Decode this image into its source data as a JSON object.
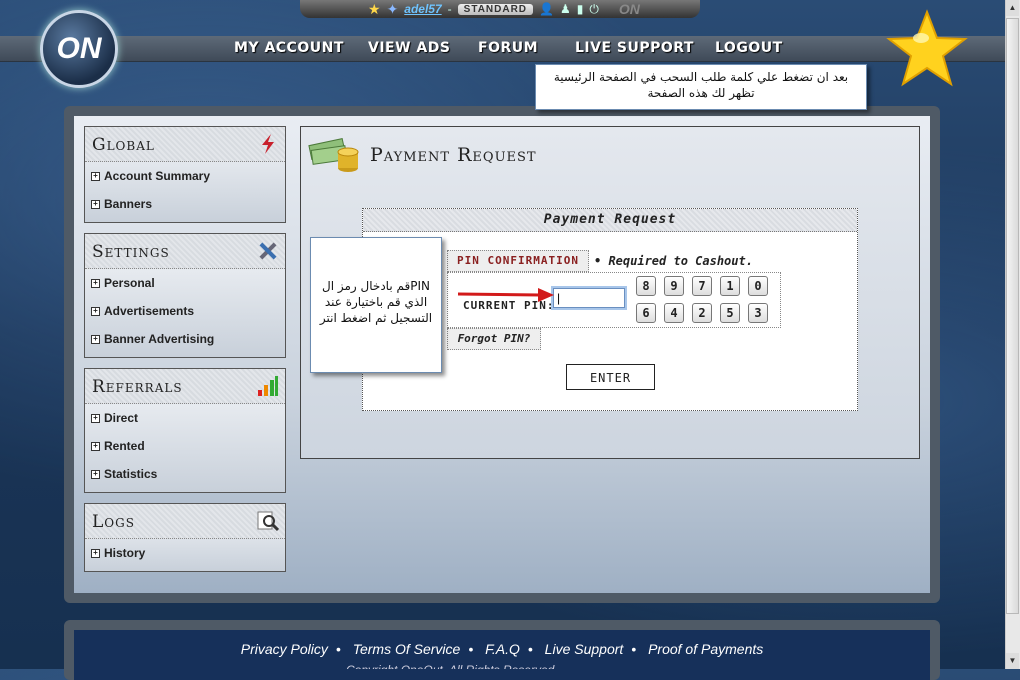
{
  "topbar": {
    "username": "adel57",
    "dash": "-",
    "membership": "STANDARD",
    "logo_small": "ON"
  },
  "logo": {
    "text": "ON"
  },
  "nav": {
    "my_account": "MY ACCOUNT",
    "view_ads": "VIEW ADS",
    "forum": "FORUM",
    "live_support": "LIVE SUPPORT",
    "logout": "LOGOUT"
  },
  "callout_top": "بعد ان تضغط علي كلمة طلب السحب في الصفحة الرئيسية تظهر لك هذه الصفحة",
  "callout_left": "PINقم بادخال رمز ال الذي قم باختيارة عند التسجيل ثم اضغط انتر",
  "sidebar": {
    "global": {
      "title": "Global",
      "items": [
        "Account Summary",
        "Banners"
      ]
    },
    "settings": {
      "title": "Settings",
      "items": [
        "Personal",
        "Advertisements",
        "Banner Advertising"
      ]
    },
    "referrals": {
      "title": "Referrals",
      "items": [
        "Direct",
        "Rented",
        "Statistics"
      ]
    },
    "logs": {
      "title": "Logs",
      "items": [
        "History"
      ]
    }
  },
  "page": {
    "title": "Payment Request",
    "form_title": "Payment Request",
    "pin_confirmation": "PIN CONFIRMATION",
    "required_note": "• Required to Cashout.",
    "current_pin_label": "CURRENT PIN:",
    "pin_value": "|",
    "keypad_row1": [
      "8",
      "9",
      "7",
      "1",
      "0"
    ],
    "keypad_row2": [
      "6",
      "4",
      "2",
      "5",
      "3"
    ],
    "forgot_pin": "Forgot PIN?",
    "enter": "ENTER"
  },
  "footer": {
    "links": [
      "Privacy Policy",
      "Terms Of Service",
      "F.A.Q",
      "Live Support",
      "Proof of Payments"
    ],
    "copyright": "Copyright OneOut. All Rights Reserved."
  },
  "colors": {
    "accent_red": "#8a2020",
    "link_blue": "#6fc4ff",
    "nav_bg": "#4f5a66",
    "footer_bg": "#16305a"
  }
}
